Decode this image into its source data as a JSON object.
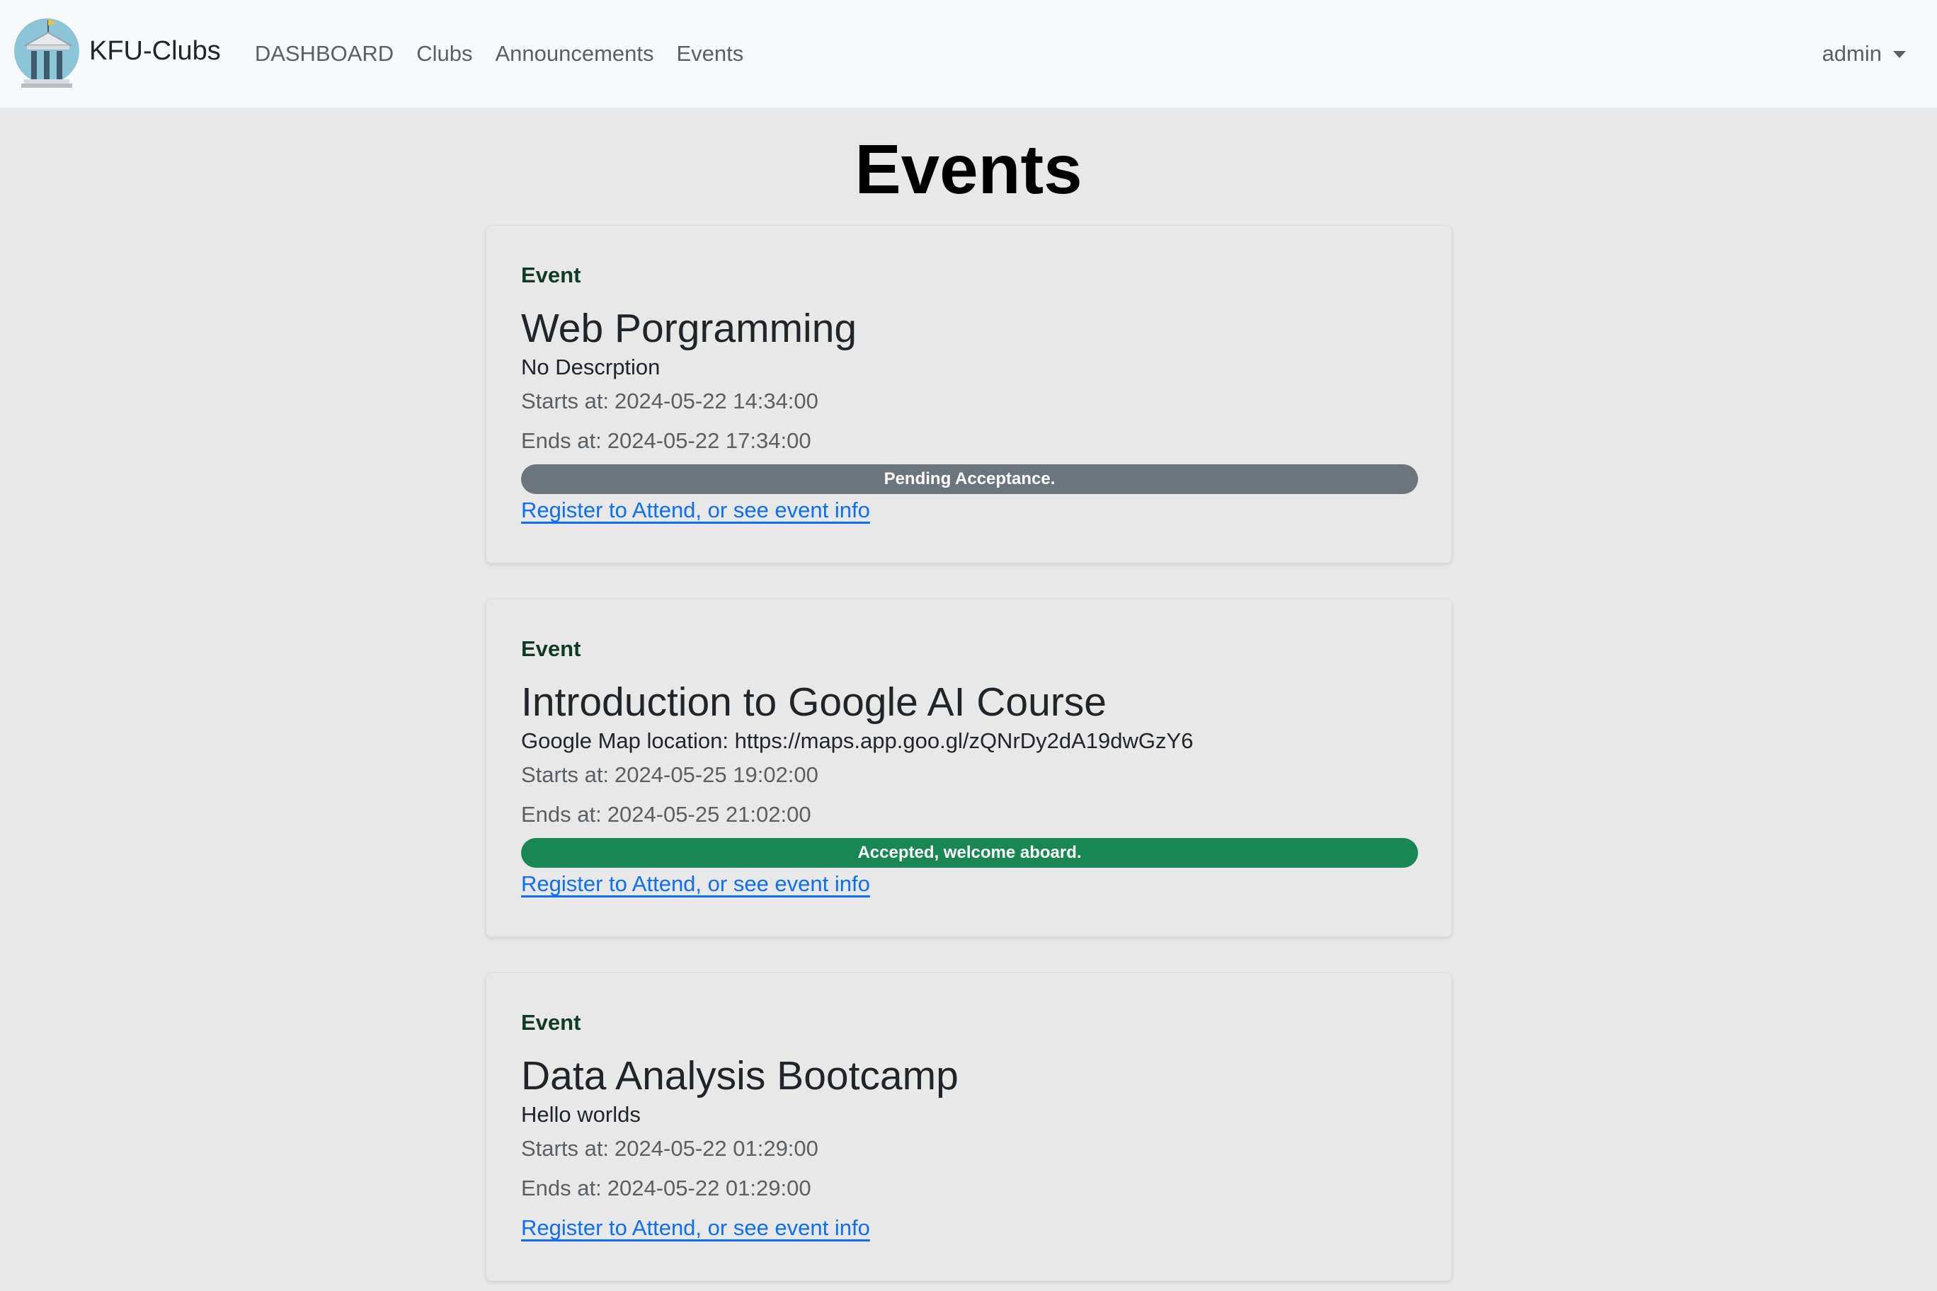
{
  "navbar": {
    "brand": "KFU-Clubs",
    "links": [
      "DASHBOARD",
      "Clubs",
      "Announcements",
      "Events"
    ],
    "user": "admin"
  },
  "page": {
    "title": "Events"
  },
  "labels": {
    "starts_prefix": "Starts at:",
    "ends_prefix": "Ends at:"
  },
  "events": [
    {
      "label": "Event",
      "title": "Web Porgramming",
      "description": "No Descrption",
      "starts": "2024-05-22 14:34:00",
      "ends": "2024-05-22 17:34:00",
      "status": "Pending Acceptance.",
      "status_color": "#6c757d",
      "link": "Register to Attend, or see event info"
    },
    {
      "label": "Event",
      "title": "Introduction to Google AI Course",
      "description": "Google Map location: https://maps.app.goo.gl/zQNrDy2dA19dwGzY6",
      "starts": "2024-05-25 19:02:00",
      "ends": "2024-05-25 21:02:00",
      "status": "Accepted, welcome aboard.",
      "status_color": "#198754",
      "link": "Register to Attend, or see event info"
    },
    {
      "label": "Event",
      "title": "Data Analysis Bootcamp",
      "description": "Hello worlds",
      "starts": "2024-05-22 01:29:00",
      "ends": "2024-05-22 01:29:00",
      "link": "Register to Attend, or see event info"
    }
  ],
  "colors": {
    "background": "#e8e8e8",
    "navbar": "#f8f9fa",
    "link": "#0d6efd",
    "label": "#0f3b24",
    "pending": "#6c757d",
    "accepted": "#198754"
  }
}
